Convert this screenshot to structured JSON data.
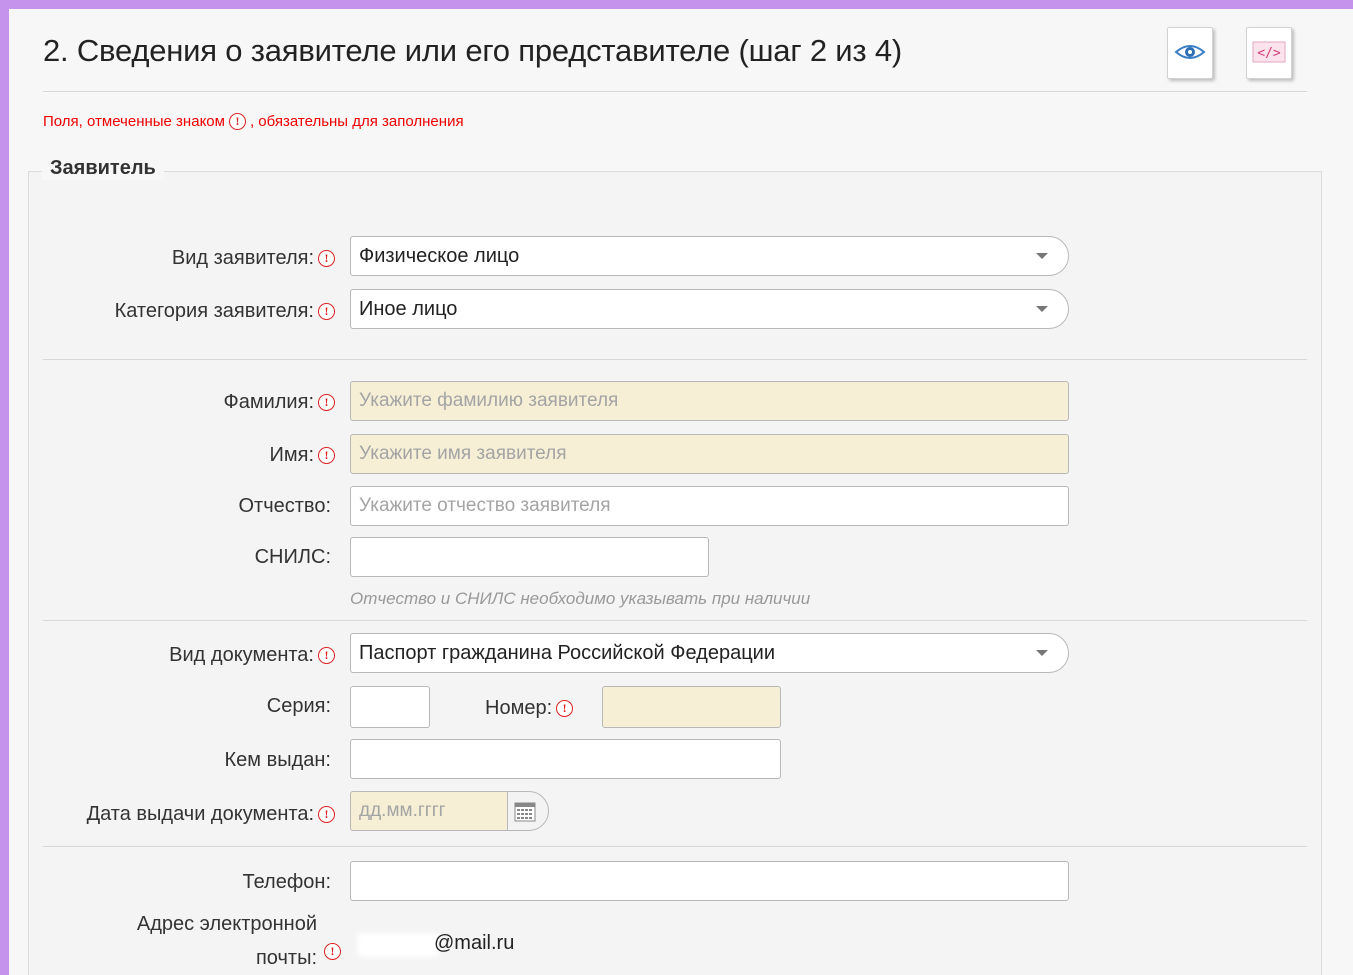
{
  "header": {
    "title": "2. Сведения о заявителе или его представителе (шаг 2 из 4)",
    "preview_icon": "eye-document-icon",
    "code_icon": "code-document-icon"
  },
  "required_note": {
    "prefix": "Поля, отмеченные знаком",
    "suffix": ", обязательны для заполнения",
    "icon_glyph": "!"
  },
  "section": {
    "legend": "Заявитель"
  },
  "fields": {
    "applicant_type": {
      "label": "Вид заявителя:",
      "value": "Физическое лицо",
      "required": true
    },
    "applicant_category": {
      "label": "Категория заявителя:",
      "value": "Иное лицо",
      "required": true
    },
    "last_name": {
      "label": "Фамилия:",
      "placeholder": "Укажите фамилию заявителя",
      "value": "",
      "required": true
    },
    "first_name": {
      "label": "Имя:",
      "placeholder": "Укажите имя заявителя",
      "value": "",
      "required": true
    },
    "patronymic": {
      "label": "Отчество:",
      "placeholder": "Укажите отчество заявителя",
      "value": "",
      "required": false
    },
    "snils": {
      "label": "СНИЛС:",
      "value": "",
      "required": false
    },
    "snils_hint": "Отчество и СНИЛС необходимо указывать при наличии",
    "document_type": {
      "label": "Вид документа:",
      "value": "Паспорт гражданина Российской Федерации",
      "required": true
    },
    "series": {
      "label": "Серия:",
      "value": "",
      "required": false
    },
    "number": {
      "label": "Номер:",
      "value": "",
      "required": true
    },
    "issued_by": {
      "label": "Кем выдан:",
      "value": "",
      "required": false
    },
    "issue_date": {
      "label": "Дата выдачи документа:",
      "placeholder": "дд.мм.гггг",
      "value": "",
      "required": true
    },
    "phone": {
      "label": "Телефон:",
      "value": "",
      "required": false
    },
    "email": {
      "label_line1": "Адрес электронной",
      "label_line2": "почты:",
      "value": "@mail.ru",
      "required": true
    }
  },
  "colors": {
    "frame": "#c592ec",
    "required_text": "#ee0000",
    "required_field_bg": "#f6efd6"
  }
}
